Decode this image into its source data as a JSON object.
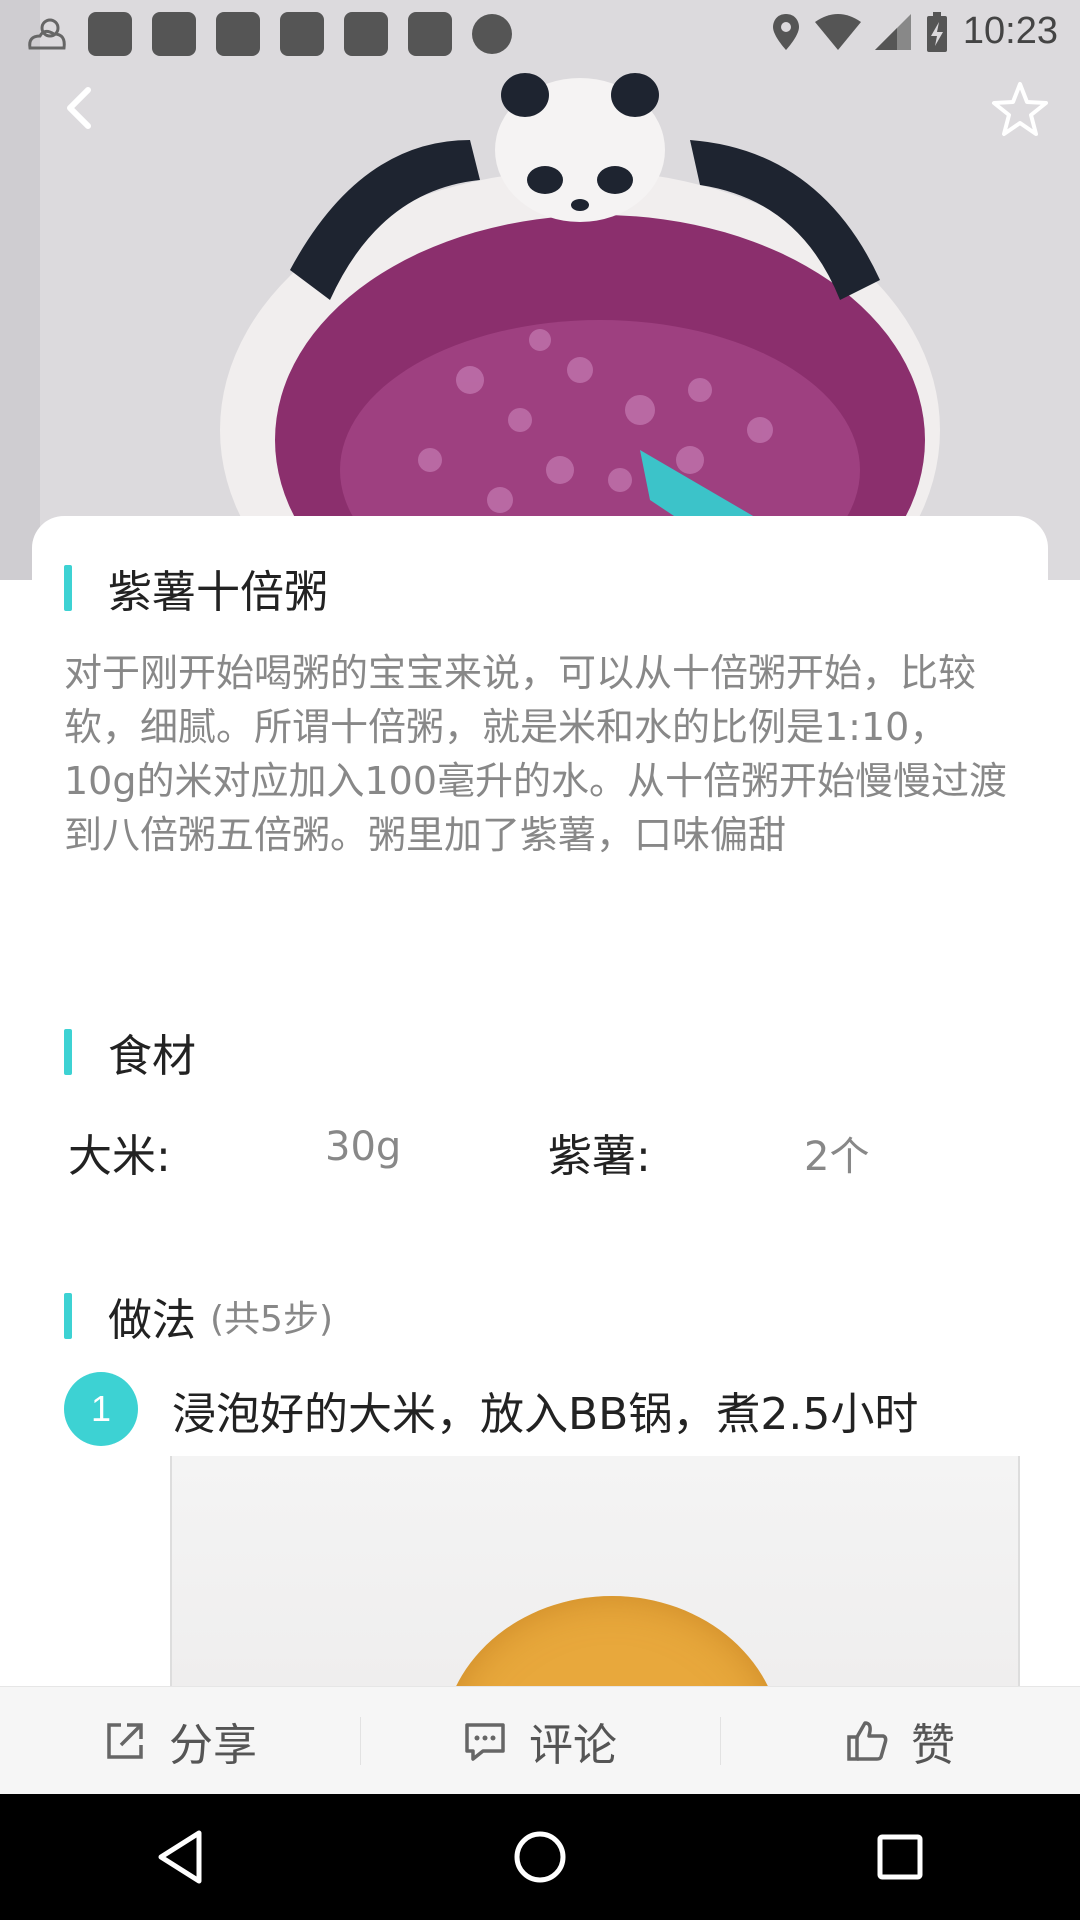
{
  "status_bar": {
    "time": "10:23",
    "icons": [
      "weather-cloudy-icon",
      "notification-icon",
      "location-icon",
      "wifi-icon",
      "signal-icon",
      "battery-charging-icon"
    ]
  },
  "header": {
    "back_icon": "chevron-left-icon",
    "favorite_icon": "star-outline-icon"
  },
  "recipe": {
    "title": "紫薯十倍粥",
    "description": "对于刚开始喝粥的宝宝来说，可以从十倍粥开始，比较软，细腻。所谓十倍粥，就是米和水的比例是1:10，10g的米对应加入100毫升的水。从十倍粥开始慢慢过渡到八倍粥五倍粥。粥里加了紫薯，口味偏甜"
  },
  "ingredients": {
    "title": "食材",
    "items": [
      {
        "name": "大米:",
        "amount": "30g"
      },
      {
        "name": "紫薯:",
        "amount": "2个"
      }
    ]
  },
  "method": {
    "title": "做法",
    "count_label": "(共5步)",
    "steps": [
      {
        "number": "1",
        "text": "浸泡好的大米，放入BB锅，煮2.5小时"
      }
    ]
  },
  "actions": {
    "share": "分享",
    "comment": "评论",
    "like": "赞"
  },
  "colors": {
    "accent": "#3dd2d3",
    "text_primary": "#222222",
    "text_secondary": "#888888"
  }
}
